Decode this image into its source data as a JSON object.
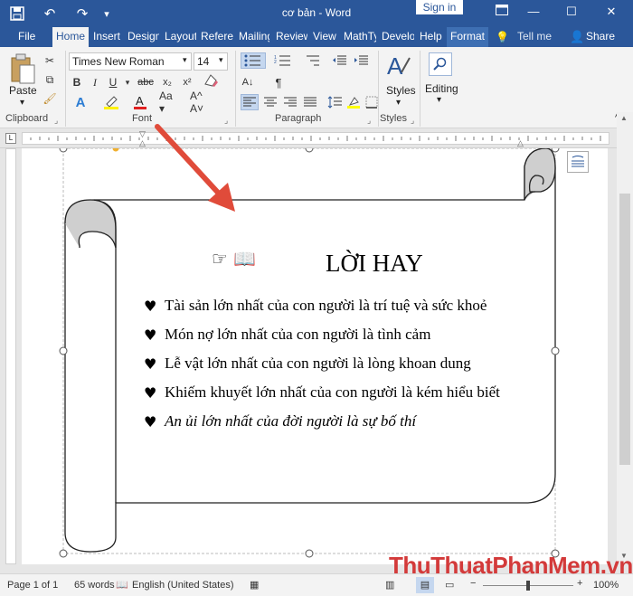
{
  "app": {
    "title": "cơ bản - Word",
    "sign_in": "Sign in"
  },
  "tabs": [
    "File",
    "Home",
    "Insert",
    "Design",
    "Layout",
    "References",
    "Mailings",
    "Review",
    "View",
    "MathType",
    "Developer",
    "Help",
    "Format"
  ],
  "tell_me": "Tell me",
  "share": "Share",
  "ribbon": {
    "font_name": "Times New Roman",
    "font_size": "14",
    "paste": "Paste",
    "styles": "Styles",
    "editing": "Editing",
    "groups": {
      "clipboard": "Clipboard",
      "font": "Font",
      "paragraph": "Paragraph",
      "styles": "Styles"
    }
  },
  "document": {
    "symbols": "☞ 📖",
    "title": "LỜI HAY",
    "bullet": "♥",
    "lines": [
      "Tài sản lớn nhất của con người là trí tuệ và sức khoẻ",
      "Món nợ lớn nhất của con người là tình cảm",
      "Lễ vật lớn nhất của con người là lòng khoan dung",
      "Khiếm khuyết lớn nhất của con người là kém hiểu biết",
      "An ủi lớn nhất của đời người là sự bố thí"
    ]
  },
  "status": {
    "page": "Page 1 of 1",
    "words": "65 words",
    "language": "English (United States)",
    "zoom": "100%"
  },
  "watermark": "ThuThuatPhanMem.vn",
  "colors": {
    "brand": "#2b579a",
    "arrow": "#e04b3a",
    "scroll_fill": "#cfcfcf"
  }
}
